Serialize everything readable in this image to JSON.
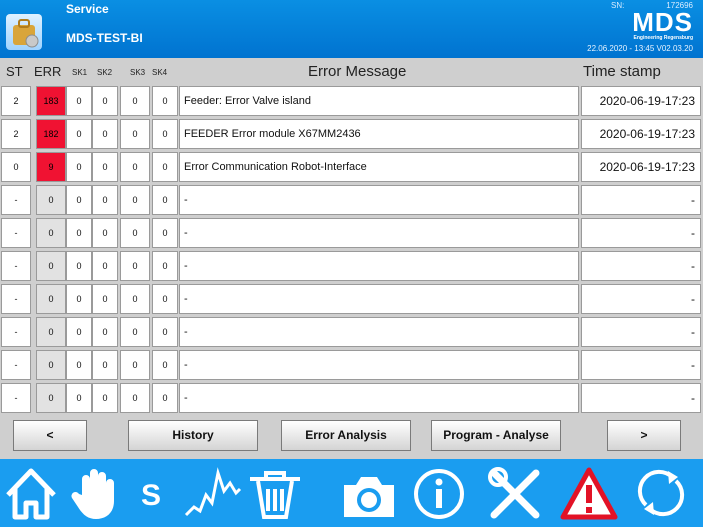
{
  "header": {
    "title": "Service",
    "subtitle": "MDS-TEST-BI",
    "sn_label": "SN:",
    "sn_value": "172696",
    "logo": "MDS",
    "logo_sub": "Engineering Regensburg",
    "datetime_version": "22.06.2020 - 13:45  V02.03.20",
    "icon": "service-bag-icon"
  },
  "columns": {
    "st": "ST",
    "err": "ERR",
    "sk1": "SK1",
    "sk2": "SK2",
    "sk3": "SK3",
    "sk4": "SK4",
    "message": "Error Message",
    "timestamp": "Time stamp"
  },
  "rows": [
    {
      "st": "2",
      "err": "183",
      "sk1": "0",
      "sk2": "0",
      "sk3": "0",
      "sk4": "0",
      "message": "Feeder: Error Valve island",
      "timestamp": "2020-06-19-17:23"
    },
    {
      "st": "2",
      "err": "182",
      "sk1": "0",
      "sk2": "0",
      "sk3": "0",
      "sk4": "0",
      "message": "FEEDER Error module X67MM2436",
      "timestamp": "2020-06-19-17:23"
    },
    {
      "st": "0",
      "err": "9",
      "sk1": "0",
      "sk2": "0",
      "sk3": "0",
      "sk4": "0",
      "message": "Error Communication Robot-Interface",
      "timestamp": "2020-06-19-17:23"
    },
    {
      "st": "-",
      "err": "0",
      "sk1": "0",
      "sk2": "0",
      "sk3": "0",
      "sk4": "0",
      "message": "-",
      "timestamp": "-"
    },
    {
      "st": "-",
      "err": "0",
      "sk1": "0",
      "sk2": "0",
      "sk3": "0",
      "sk4": "0",
      "message": "-",
      "timestamp": "-"
    },
    {
      "st": "-",
      "err": "0",
      "sk1": "0",
      "sk2": "0",
      "sk3": "0",
      "sk4": "0",
      "message": "-",
      "timestamp": "-"
    },
    {
      "st": "-",
      "err": "0",
      "sk1": "0",
      "sk2": "0",
      "sk3": "0",
      "sk4": "0",
      "message": "-",
      "timestamp": "-"
    },
    {
      "st": "-",
      "err": "0",
      "sk1": "0",
      "sk2": "0",
      "sk3": "0",
      "sk4": "0",
      "message": "-",
      "timestamp": "-"
    },
    {
      "st": "-",
      "err": "0",
      "sk1": "0",
      "sk2": "0",
      "sk3": "0",
      "sk4": "0",
      "message": "-",
      "timestamp": "-"
    },
    {
      "st": "-",
      "err": "0",
      "sk1": "0",
      "sk2": "0",
      "sk3": "0",
      "sk4": "0",
      "message": "-",
      "timestamp": "-"
    }
  ],
  "buttons": {
    "prev": "<",
    "history": "History",
    "error_analysis": "Error Analysis",
    "program_analyse": "Program - Analyse",
    "next": ">"
  },
  "toolbar": {
    "s_label": "S",
    "icons": [
      "home-icon",
      "hand-icon",
      "s-icon",
      "chart-icon",
      "trash-icon",
      "camera-icon",
      "info-icon",
      "tools-icon",
      "warning-icon",
      "refresh-icon"
    ]
  },
  "colors": {
    "header": "#0a8fe3",
    "toolbar": "#1a9df0",
    "active_error": "#f01232",
    "background": "#cfcfcf"
  }
}
